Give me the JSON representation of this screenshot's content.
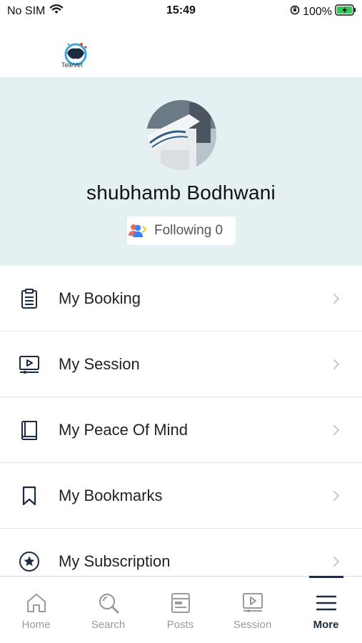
{
  "status_bar": {
    "carrier": "No SIM",
    "time": "15:49",
    "battery": "100%"
  },
  "header": {
    "logo_text": "TeleVet"
  },
  "profile": {
    "name": "shubhamb Bodhwani",
    "following_label": "Following 0"
  },
  "menu": {
    "items": [
      {
        "label": "My Booking",
        "icon": "clipboard-icon"
      },
      {
        "label": "My Session",
        "icon": "video-session-icon"
      },
      {
        "label": "My Peace Of Mind",
        "icon": "book-icon"
      },
      {
        "label": "My Bookmarks",
        "icon": "bookmark-icon"
      },
      {
        "label": "My Subscription",
        "icon": "star-badge-icon"
      }
    ]
  },
  "tab_bar": {
    "tabs": [
      {
        "label": "Home",
        "icon": "home-icon"
      },
      {
        "label": "Search",
        "icon": "search-icon"
      },
      {
        "label": "Posts",
        "icon": "posts-icon"
      },
      {
        "label": "Session",
        "icon": "session-icon"
      },
      {
        "label": "More",
        "icon": "menu-icon"
      }
    ],
    "active": "More"
  },
  "colors": {
    "profile_bg": "#e4f0f1",
    "icon_navy": "#1c2b40",
    "battery_green": "#34c759"
  }
}
